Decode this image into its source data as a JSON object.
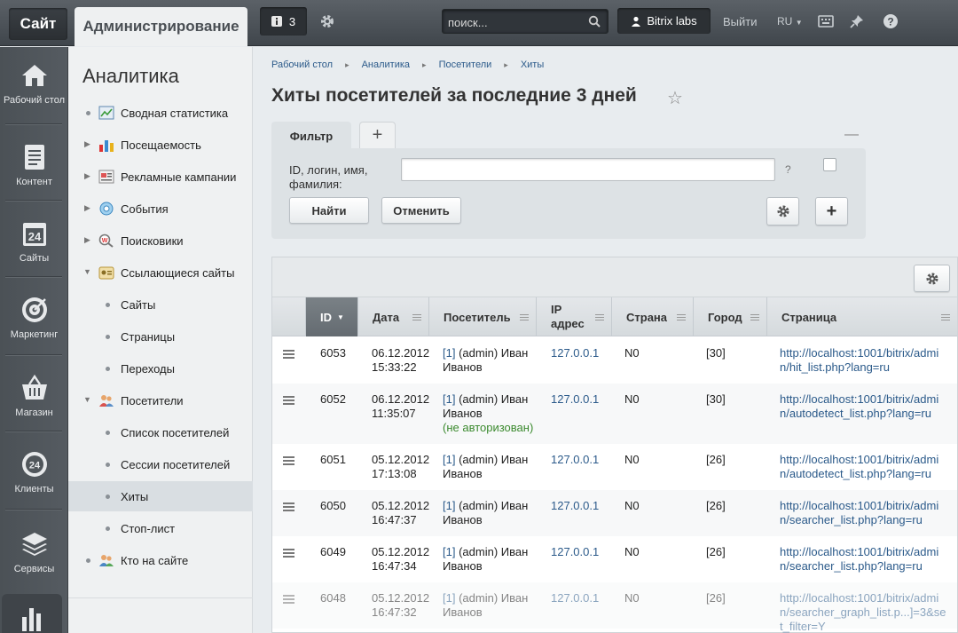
{
  "topbar": {
    "site_label": "Сайт",
    "admin_label": "Администрирование",
    "notifications_count": "3",
    "search_placeholder": "поиск...",
    "user_label": "Bitrix labs",
    "logout_label": "Выйти",
    "lang_label": "RU"
  },
  "rail": [
    {
      "label": "Рабочий стол",
      "icon": "home-icon"
    },
    {
      "label": "Контент",
      "icon": "document-icon"
    },
    {
      "label": "Сайты",
      "icon": "calendar-24-icon"
    },
    {
      "label": "Маркетинг",
      "icon": "target-icon"
    },
    {
      "label": "Магазин",
      "icon": "basket-icon"
    },
    {
      "label": "Клиенты",
      "icon": "clients-24-icon"
    },
    {
      "label": "Сервисы",
      "icon": "layers-icon"
    }
  ],
  "menu": {
    "title": "Аналитика",
    "items": [
      {
        "label": "Сводная статистика",
        "marker": "bullet",
        "icon": "summary-icon"
      },
      {
        "label": "Посещаемость",
        "marker": "arrow-right",
        "icon": "bars-icon"
      },
      {
        "label": "Рекламные кампании",
        "marker": "arrow-right",
        "icon": "campaign-icon"
      },
      {
        "label": "События",
        "marker": "arrow-right",
        "icon": "events-icon"
      },
      {
        "label": "Поисковики",
        "marker": "arrow-right",
        "icon": "search-engines-icon"
      },
      {
        "label": "Ссылающиеся сайты",
        "marker": "arrow-down",
        "icon": "referrers-icon"
      },
      {
        "label": "Сайты",
        "marker": "bullet-sub"
      },
      {
        "label": "Страницы",
        "marker": "bullet-sub"
      },
      {
        "label": "Переходы",
        "marker": "bullet-sub"
      },
      {
        "label": "Посетители",
        "marker": "arrow-down",
        "icon": "visitors-icon"
      },
      {
        "label": "Список посетителей",
        "marker": "bullet-sub"
      },
      {
        "label": "Сессии посетителей",
        "marker": "bullet-sub"
      },
      {
        "label": "Хиты",
        "marker": "bullet-sub",
        "active": true
      },
      {
        "label": "Стоп-лист",
        "marker": "bullet-sub"
      },
      {
        "label": "Кто на сайте",
        "marker": "bullet",
        "icon": "who-online-icon"
      }
    ]
  },
  "breadcrumbs": [
    "Рабочий стол",
    "Аналитика",
    "Посетители",
    "Хиты"
  ],
  "page_title": "Хиты посетителей за последние 3 дней",
  "filter": {
    "tab_label": "Фильтр",
    "field_label": "ID, логин, имя, фамилия:",
    "field_value": "",
    "help": "?",
    "find_button": "Найти",
    "cancel_button": "Отменить"
  },
  "table": {
    "columns": [
      "ID",
      "Дата",
      "Посетитель",
      "IP адрес",
      "Страна",
      "Город",
      "Страница"
    ],
    "rows": [
      {
        "id": "6053",
        "date": "06.12.2012",
        "time": "15:33:22",
        "visitor_num": "[1]",
        "visitor": " (admin) Иван Иванов",
        "note": "",
        "ip": "127.0.0.1",
        "country": "N0",
        "city": "[30]",
        "page": "http://localhost:1001/bitrix/admin/hit_list.php?lang=ru"
      },
      {
        "id": "6052",
        "date": "06.12.2012",
        "time": "11:35:07",
        "visitor_num": "[1]",
        "visitor": " (admin) Иван Иванов",
        "note": "(не авторизован)",
        "ip": "127.0.0.1",
        "country": "N0",
        "city": "[30]",
        "page": "http://localhost:1001/bitrix/admin/autodetect_list.php?lang=ru"
      },
      {
        "id": "6051",
        "date": "05.12.2012",
        "time": "17:13:08",
        "visitor_num": "[1]",
        "visitor": " (admin) Иван Иванов",
        "note": "",
        "ip": "127.0.0.1",
        "country": "N0",
        "city": "[26]",
        "page": "http://localhost:1001/bitrix/admin/autodetect_list.php?lang=ru"
      },
      {
        "id": "6050",
        "date": "05.12.2012",
        "time": "16:47:37",
        "visitor_num": "[1]",
        "visitor": " (admin) Иван Иванов",
        "note": "",
        "ip": "127.0.0.1",
        "country": "N0",
        "city": "[26]",
        "page": "http://localhost:1001/bitrix/admin/searcher_list.php?lang=ru"
      },
      {
        "id": "6049",
        "date": "05.12.2012",
        "time": "16:47:34",
        "visitor_num": "[1]",
        "visitor": " (admin) Иван Иванов",
        "note": "",
        "ip": "127.0.0.1",
        "country": "N0",
        "city": "[26]",
        "page": "http://localhost:1001/bitrix/admin/searcher_list.php?lang=ru"
      },
      {
        "id": "6048",
        "date": "05.12.2012",
        "time": "16:47:32",
        "visitor_num": "[1]",
        "visitor": " (admin) Иван Иванов",
        "note": "",
        "ip": "127.0.0.1",
        "country": "N0",
        "city": "[26]",
        "page": "http://localhost:1001/bitrix/admin/searcher_graph_list.p...]=3&set_filter=Y"
      }
    ]
  }
}
